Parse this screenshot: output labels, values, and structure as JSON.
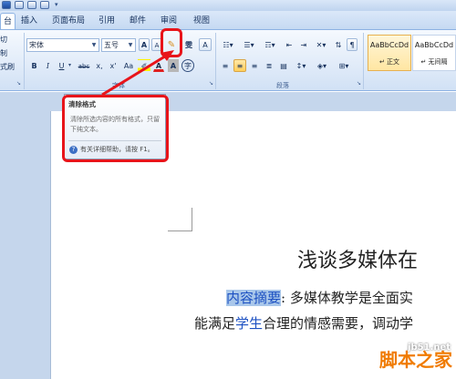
{
  "titlebar": {
    "qat_icons": [
      "word-icon",
      "save-icon",
      "undo-icon",
      "redo-icon",
      "customize-icon"
    ]
  },
  "tabs": [
    {
      "label": "台",
      "active": true
    },
    {
      "label": "插入"
    },
    {
      "label": "页面布局"
    },
    {
      "label": "引用"
    },
    {
      "label": "邮件"
    },
    {
      "label": "审阅"
    },
    {
      "label": "视图"
    }
  ],
  "clipboard": {
    "cut": "切",
    "copy": "制",
    "format_painter": "式刷"
  },
  "font": {
    "font_name": "宋体",
    "font_size": "五号",
    "grow_icon": "A",
    "shrink_icon": "A",
    "wen_icon": "雯",
    "bold": "B",
    "italic": "I",
    "underline": "U",
    "strike": "abc",
    "subscript": "x,",
    "superscript": "x'",
    "change_case": "Aa",
    "font_color": "A",
    "char_shading": "A",
    "group_label": "字体"
  },
  "paragraph": {
    "group_label": "段落"
  },
  "styles": [
    {
      "sample": "AaBbCcDd",
      "name": "正文",
      "selected": true
    },
    {
      "sample": "AaBbCcDd",
      "name": "无间隔",
      "selected": false
    }
  ],
  "tooltip": {
    "title": "清除格式",
    "body": "清除所选内容的所有格式，只留下纯文本。",
    "help": "有关详细帮助，请按 F1。"
  },
  "document": {
    "heading": "浅谈多媒体在",
    "line1_hl": "内容摘要",
    "line1_rest": ": 多媒体教学是全面实",
    "line2_a": "能满足",
    "line2_blue": "学生",
    "line2_b": "合理的情感需要，调动",
    "line2_tail": "学"
  },
  "watermark": {
    "url": "jb51.net",
    "logo": "脚本之家"
  },
  "colors": {
    "highlight": "#a9c7ea",
    "annotation_red": "#e8141a",
    "link_blue": "#1c50c2"
  }
}
